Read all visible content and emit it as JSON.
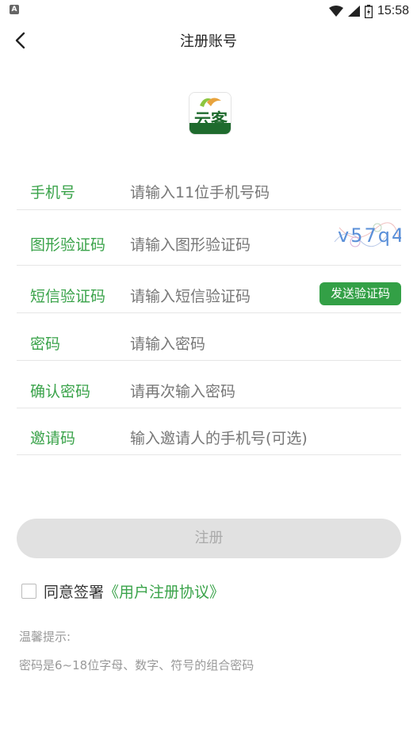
{
  "status_bar": {
    "time": "15:58",
    "app_icon_letter": "A"
  },
  "nav": {
    "title": "注册账号"
  },
  "logo": {
    "text": "云客"
  },
  "form": {
    "phone": {
      "label": "手机号",
      "placeholder": "请输入11位手机号码"
    },
    "captcha": {
      "label": "图形验证码",
      "placeholder": "请输入图形验证码",
      "image_text": "v57q4"
    },
    "sms": {
      "label": "短信验证码",
      "placeholder": "请输入短信验证码",
      "button_label": "发送验证码"
    },
    "password": {
      "label": "密码",
      "placeholder": "请输入密码"
    },
    "confirm": {
      "label": "确认密码",
      "placeholder": "请再次输入密码"
    },
    "invite": {
      "label": "邀请码",
      "placeholder": "输入邀请人的手机号(可选)"
    }
  },
  "submit": {
    "label": "注册"
  },
  "agreement": {
    "text": "同意签署",
    "link": "《用户注册协议》"
  },
  "tips": {
    "title": "温馨提示:",
    "body": "密码是6~18位字母、数字、符号的组合密码"
  },
  "colors": {
    "accent": "#3aa34a",
    "button_green": "#33a046",
    "disabled_bg": "#e1e1e1"
  }
}
